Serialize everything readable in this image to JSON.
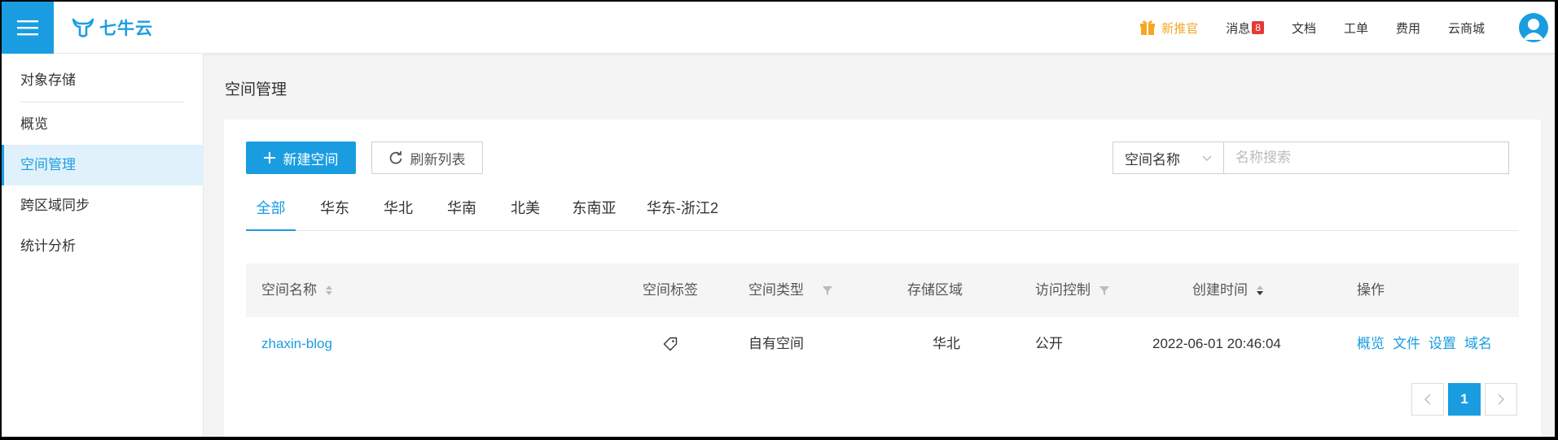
{
  "header": {
    "brand": "七牛云",
    "nav": {
      "promo": "新推官",
      "messages": "消息",
      "messages_count": "8",
      "docs": "文档",
      "tickets": "工单",
      "billing": "费用",
      "store": "云商城"
    }
  },
  "sidebar": {
    "title": "对象存储",
    "items": [
      {
        "label": "概览"
      },
      {
        "label": "空间管理"
      },
      {
        "label": "跨区域同步"
      },
      {
        "label": "统计分析"
      }
    ]
  },
  "main": {
    "page_title": "空间管理",
    "toolbar": {
      "new_bucket": "新建空间",
      "refresh": "刷新列表",
      "search_field_selected": "空间名称",
      "search_placeholder": "名称搜索"
    },
    "tabs": [
      "全部",
      "华东",
      "华北",
      "华南",
      "北美",
      "东南亚",
      "华东-浙江2"
    ],
    "active_tab": "全部",
    "table": {
      "columns": [
        "空间名称",
        "空间标签",
        "空间类型",
        "存储区域",
        "访问控制",
        "创建时间",
        "操作"
      ],
      "rows": [
        {
          "name": "zhaxin-blog",
          "type": "自有空间",
          "region": "华北",
          "access": "公开",
          "created": "2022-06-01 20:46:04",
          "actions": [
            "概览",
            "文件",
            "设置",
            "域名"
          ]
        }
      ]
    },
    "pagination": {
      "current": "1"
    }
  },
  "colors": {
    "accent": "#1a9de0",
    "promo": "#f5a623",
    "badge": "#e53935"
  }
}
